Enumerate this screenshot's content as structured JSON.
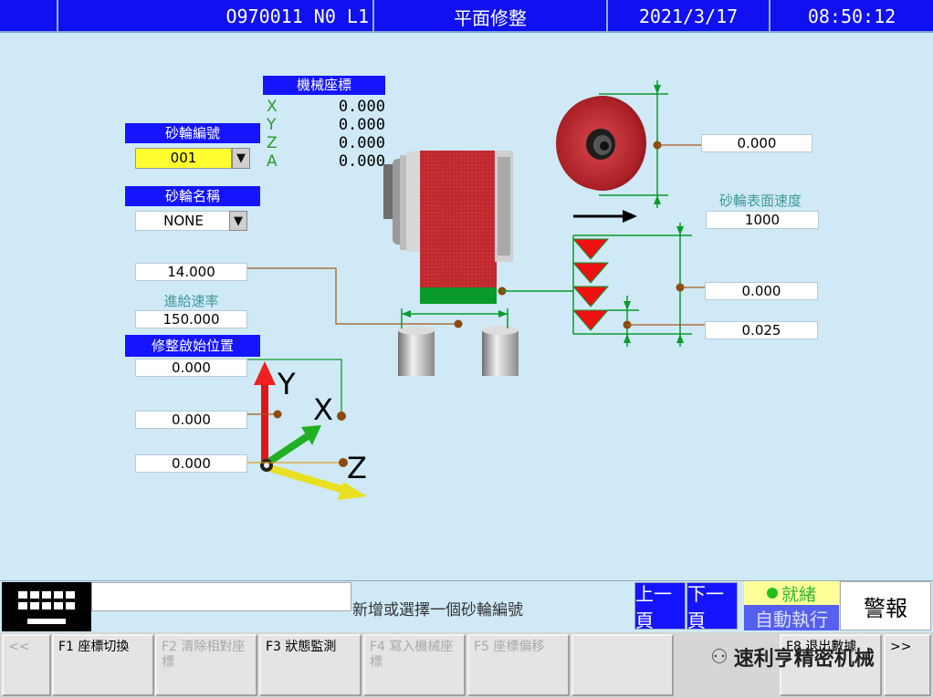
{
  "header": {
    "program": "O970011 N0 L1",
    "title": "平面修整",
    "date": "2021/3/17",
    "time": "08:50:12"
  },
  "machine_coords": {
    "title": "機械座標",
    "axes": [
      {
        "label": "X",
        "value": "0.000"
      },
      {
        "label": "Y",
        "value": "0.000"
      },
      {
        "label": "Z",
        "value": "0.000"
      },
      {
        "label": "A",
        "value": "0.000"
      }
    ]
  },
  "wheel_number": {
    "label": "砂輪編號",
    "value": "001"
  },
  "wheel_name": {
    "label": "砂輪名稱",
    "value": "NONE"
  },
  "left_value": "14.000",
  "feed_rate": {
    "label": "進給速率",
    "value": "150.000"
  },
  "dress_start": {
    "label": "修整啟始位置",
    "values": [
      "0.000",
      "0.000",
      "0.000"
    ]
  },
  "wheel_diameter": "0.000",
  "surface_speed": {
    "label": "砂輪表面速度",
    "value": "1000"
  },
  "dress_total": "0.000",
  "dress_step": "0.025",
  "axis_labels": {
    "y": "Y",
    "x": "X",
    "z": "Z"
  },
  "message": "新增或選擇一個砂輪編號",
  "nav": {
    "prev": "上一頁",
    "next": "下一頁"
  },
  "status": {
    "ready": "就緒",
    "mode": "自動執行"
  },
  "alarm": "警報",
  "fkeys": [
    {
      "label": "<<",
      "enabled": false
    },
    {
      "label": "F1 座標切換",
      "enabled": true
    },
    {
      "label": "F2 清除相對座標",
      "enabled": false
    },
    {
      "label": "F3 狀態監測",
      "enabled": true
    },
    {
      "label": "F4 寫入機械座標",
      "enabled": false
    },
    {
      "label": "F5 座標偏移",
      "enabled": false
    },
    {
      "label": "F8 退出數據",
      "enabled": true
    },
    {
      "label": ">>",
      "enabled": true
    }
  ],
  "watermark": "速利亨精密机械",
  "colors": {
    "header_blue": "#1010f0",
    "label_blue": "#1414ff",
    "background": "#cfe9f7",
    "wheel_red": "#c0282e",
    "dress_green": "#0a9a2a"
  }
}
